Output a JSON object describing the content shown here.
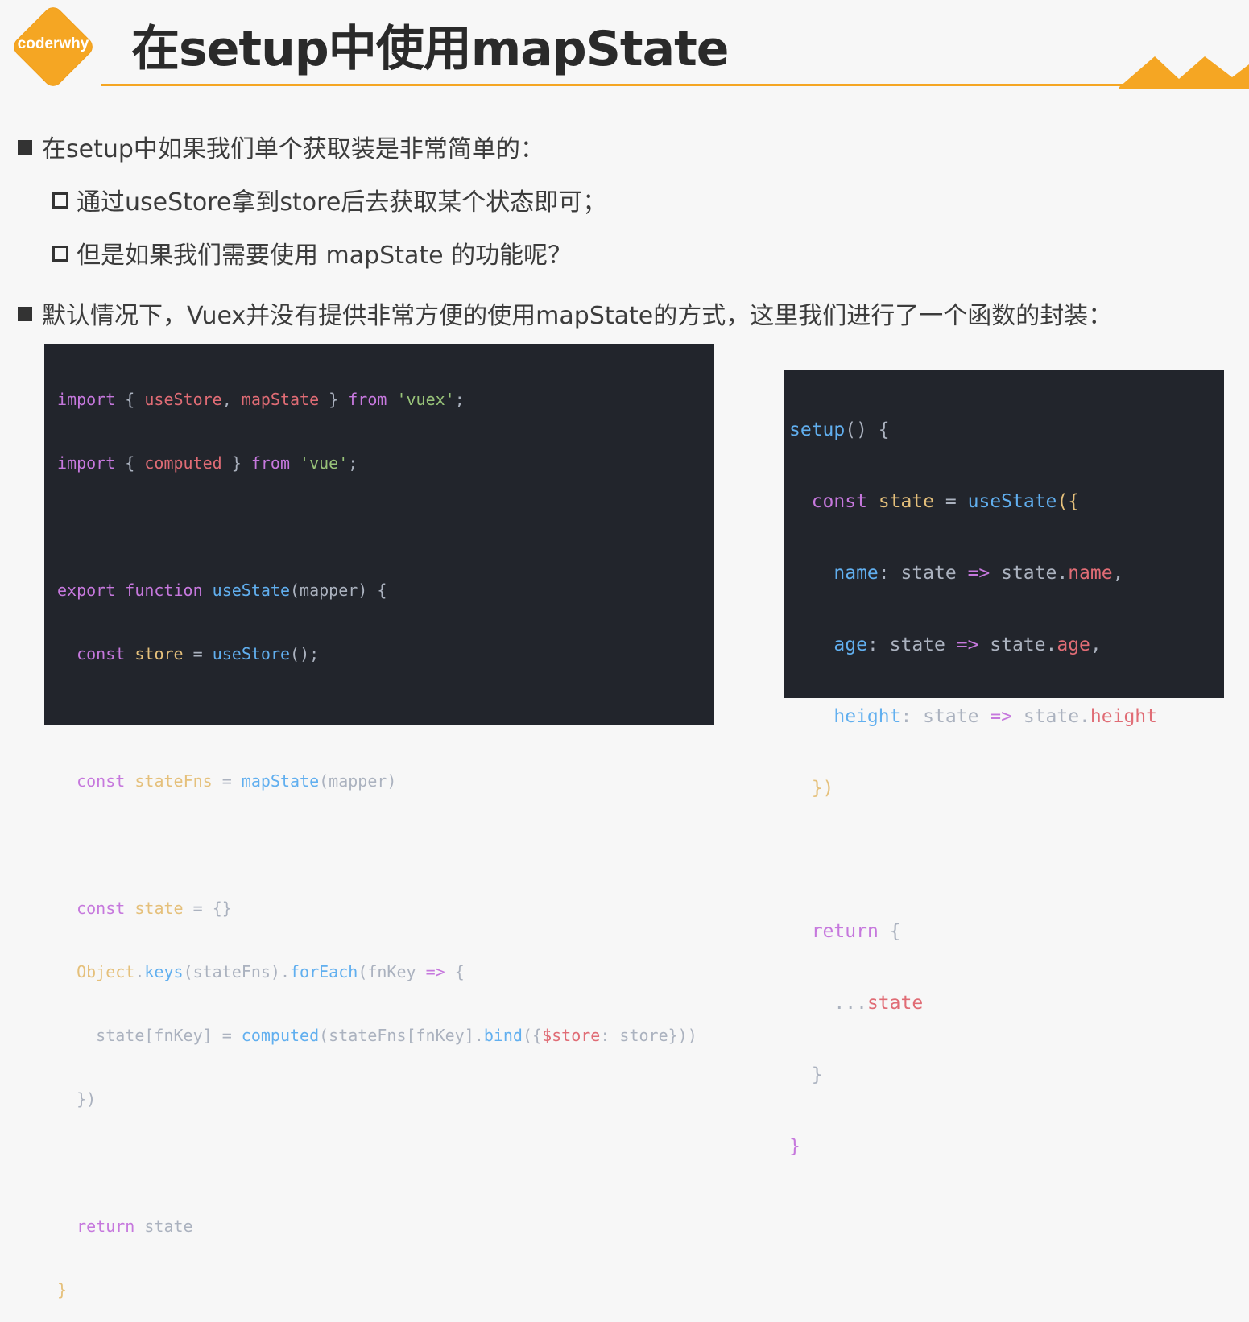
{
  "logo": {
    "text": "coderwhy"
  },
  "title": "在setup中使用mapState",
  "bullets": [
    {
      "level": 1,
      "text": "在setup中如果我们单个获取装是非常简单的："
    },
    {
      "level": 2,
      "text": "通过useStore拿到store后去获取某个状态即可；"
    },
    {
      "level": 2,
      "text": "但是如果我们需要使用 mapState 的功能呢？"
    },
    {
      "level": 1,
      "text": "默认情况下，Vuex并没有提供非常方便的使用mapState的方式，这里我们进行了一个函数的封装："
    }
  ],
  "code_left": {
    "lines": [
      "import { useStore, mapState } from 'vuex';",
      "import { computed } from 'vue';",
      "",
      "export function useState(mapper) {",
      "  const store = useStore();",
      "",
      "  const stateFns = mapState(mapper)",
      "",
      "  const state = {}",
      "  Object.keys(stateFns).forEach(fnKey => {",
      "    state[fnKey] = computed(stateFns[fnKey].bind({$store: store}))",
      "  })",
      "",
      "  return state",
      "}"
    ]
  },
  "code_right": {
    "lines": [
      "setup() {",
      "  const state = useState({",
      "    name: state => state.name,",
      "    age: state => state.age,",
      "    height: state => state.height",
      "  })",
      "",
      "  return {",
      "    ...state",
      "  }",
      "}"
    ]
  },
  "colors": {
    "accent": "#f5a623",
    "code_bg": "#22252c",
    "keyword": "#c678dd",
    "function": "#61afef",
    "variable": "#e5c07b",
    "string": "#98c379"
  }
}
